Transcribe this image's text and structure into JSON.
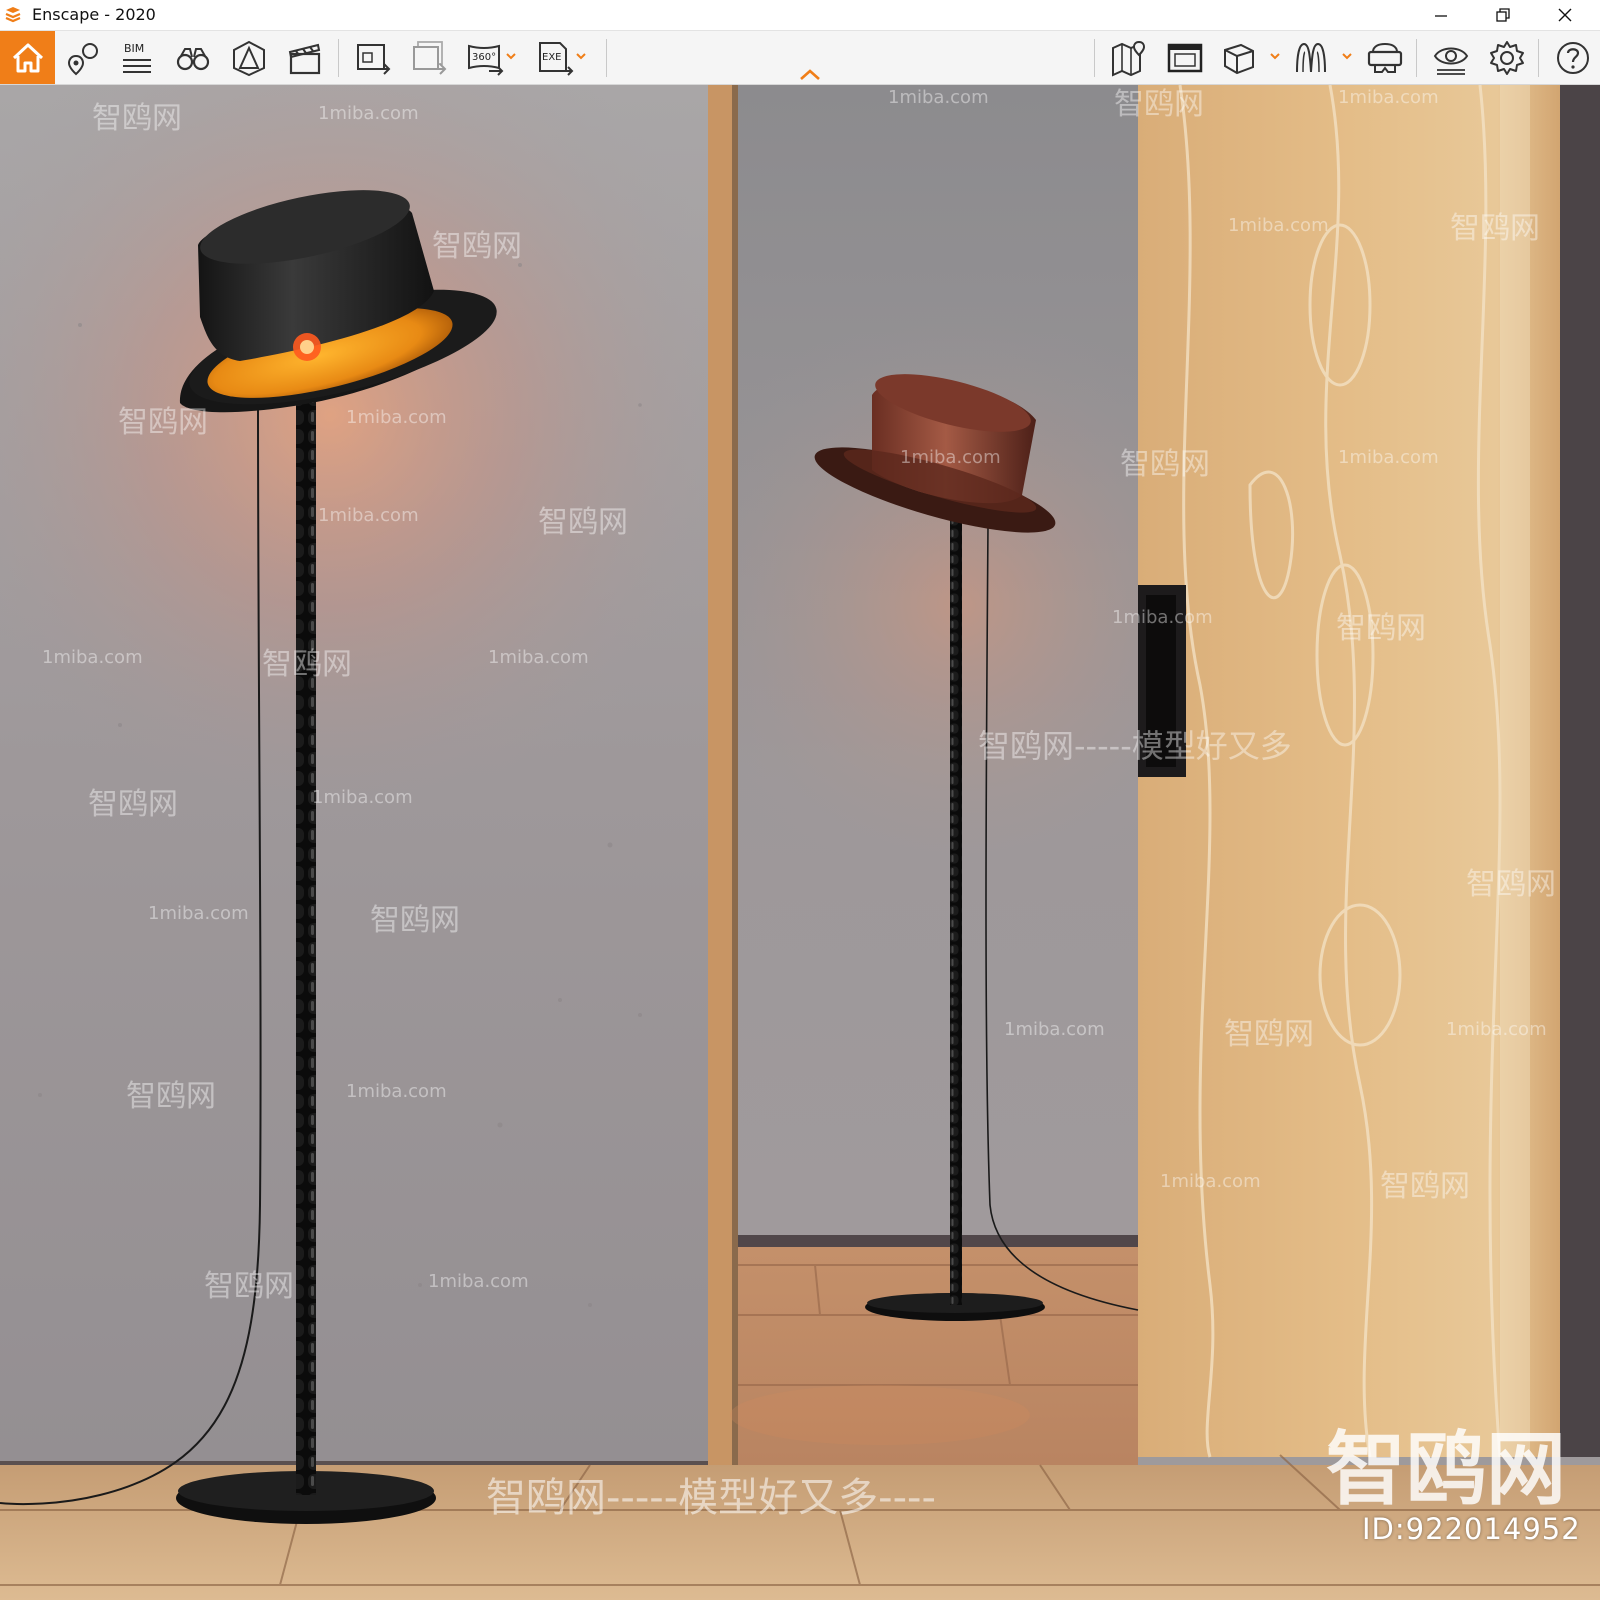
{
  "window": {
    "title": "Enscape - 2020",
    "controls": [
      "minimize",
      "restore",
      "close"
    ]
  },
  "toolbar": {
    "accent_color": "#f07e18",
    "left_buttons": [
      {
        "name": "home",
        "icon": "home-icon"
      },
      {
        "name": "views",
        "icon": "location-pin-icon"
      },
      {
        "name": "bim",
        "icon": "bim-icon",
        "label": "BIM"
      },
      {
        "name": "binoculars",
        "icon": "binoculars-icon"
      },
      {
        "name": "sun-position",
        "icon": "pyramid-icon"
      },
      {
        "name": "video",
        "icon": "clapperboard-icon"
      },
      {
        "name": "render-screenshot",
        "icon": "screenshot-export-icon"
      },
      {
        "name": "batch-render",
        "icon": "batch-export-icon"
      },
      {
        "name": "panorama",
        "icon": "panorama-360-icon",
        "label": "360°",
        "has_dropdown": true
      },
      {
        "name": "exe-export",
        "icon": "exe-export-icon",
        "label": "EXE",
        "has_dropdown": true
      }
    ],
    "right_buttons": [
      {
        "name": "map",
        "icon": "map-icon"
      },
      {
        "name": "web-standalone",
        "icon": "web-export-icon"
      },
      {
        "name": "asset-library",
        "icon": "cube-icon",
        "has_dropdown": true
      },
      {
        "name": "material-editor",
        "icon": "materials-icon",
        "has_dropdown": true
      },
      {
        "name": "vr-headset",
        "icon": "vr-headset-icon"
      },
      {
        "name": "visual-settings",
        "icon": "eye-icon"
      },
      {
        "name": "general-settings",
        "icon": "gear-icon"
      },
      {
        "name": "help",
        "icon": "help-icon"
      }
    ]
  },
  "viewport": {
    "scene": "Two top-hat floor lamps in front of a concrete wall with an oak sliding door",
    "watermarks": {
      "small_cn": "智鸥网",
      "small_url": "1miba.com",
      "mid_slogan": "智鸥网-----模型好又多",
      "big_logo": "智鸥网",
      "bottom_slogan": "智鸥网-----模型好又多----",
      "id_text": "ID:922014952"
    }
  }
}
